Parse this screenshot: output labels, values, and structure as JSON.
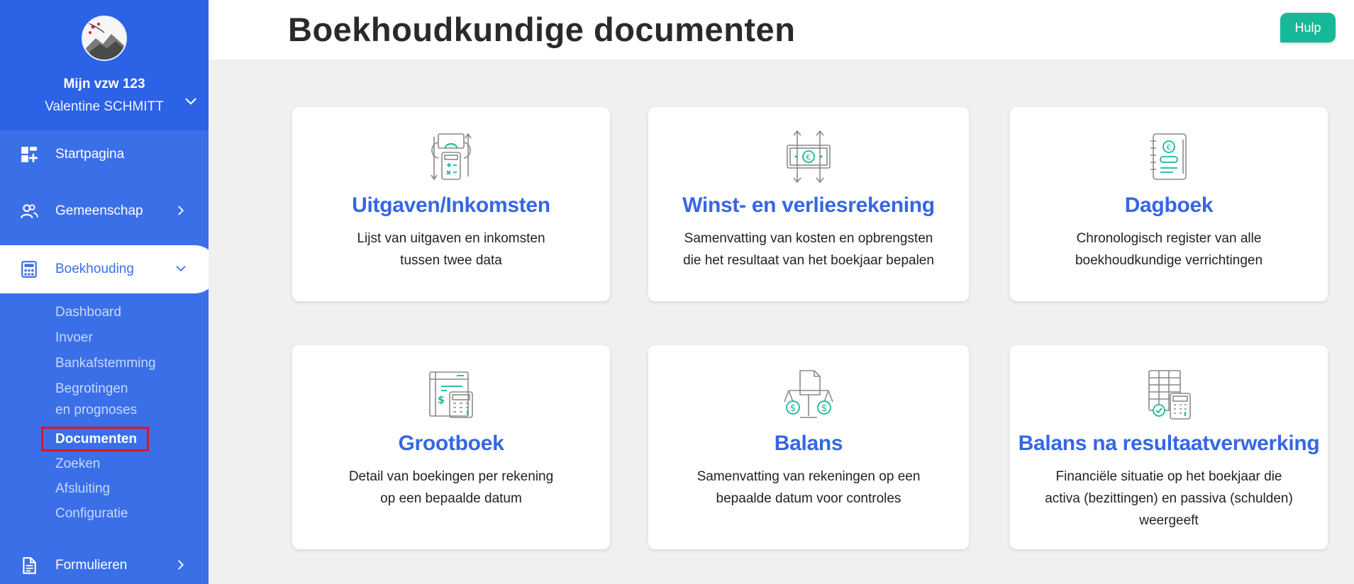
{
  "sidebar": {
    "org_name": "Mijn vzw 123",
    "user_name": "Valentine SCHMITT",
    "nav": [
      {
        "label": "Startpagina",
        "icon": "dashboard-grid-icon"
      },
      {
        "label": "Gemeenschap",
        "icon": "users-icon"
      },
      {
        "label": "Boekhouding",
        "icon": "calculator-icon"
      },
      {
        "label": "Formulieren",
        "icon": "document-icon"
      }
    ],
    "sub": [
      "Dashboard",
      "Invoer",
      "Bankafstemming",
      "Begrotingen",
      "en prognoses",
      "Documenten",
      "Zoeken",
      "Afsluiting",
      "Configuratie"
    ]
  },
  "header": {
    "title": "Boekhoudkundige documenten",
    "help_label": "Hulp"
  },
  "cards": [
    {
      "title": "Uitgaven/Inkomsten",
      "desc1": "Lijst van uitgaven en inkomsten",
      "desc2": "tussen twee data",
      "desc3": ""
    },
    {
      "title": "Winst- en verliesrekening",
      "desc1": "Samenvatting van kosten en opbrengsten",
      "desc2": "die het resultaat van het boekjaar bepalen",
      "desc3": ""
    },
    {
      "title": "Dagboek",
      "desc1": "Chronologisch register van alle",
      "desc2": "boekhoudkundige verrichtingen",
      "desc3": ""
    },
    {
      "title": "Grootboek",
      "desc1": "Detail van boekingen per rekening",
      "desc2": "op een bepaalde datum",
      "desc3": ""
    },
    {
      "title": "Balans",
      "desc1": "Samenvatting van rekeningen op een",
      "desc2": "bepaalde datum voor controles",
      "desc3": ""
    },
    {
      "title": "Balans na resultaatverwerking",
      "desc1": "Financiële situatie op het boekjaar die",
      "desc2": "activa (bezittingen) en passiva (schulden)",
      "desc3": "weergeeft"
    }
  ],
  "colors": {
    "sidebar": "#3a6fe8",
    "accent": "#3566e4",
    "help": "#17b897",
    "highlight": "#e0141e"
  }
}
